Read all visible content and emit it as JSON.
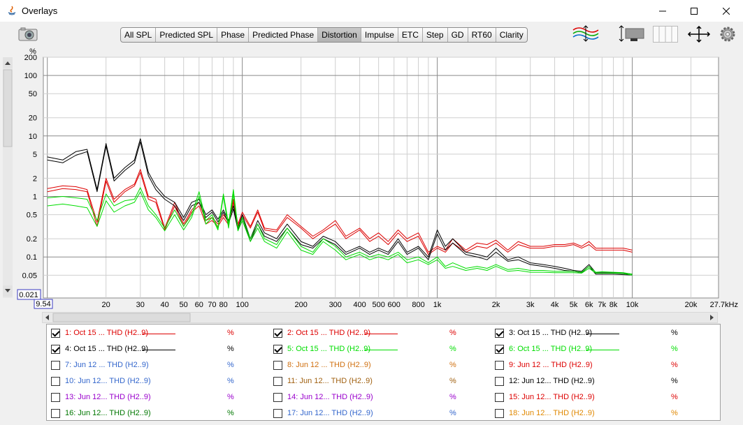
{
  "window": {
    "title": "Overlays"
  },
  "tabs": [
    {
      "label": "All SPL",
      "active": false
    },
    {
      "label": "Predicted SPL",
      "active": false
    },
    {
      "label": "Phase",
      "active": false
    },
    {
      "label": "Predicted Phase",
      "active": false
    },
    {
      "label": "Distortion",
      "active": true
    },
    {
      "label": "Impulse",
      "active": false
    },
    {
      "label": "ETC",
      "active": false
    },
    {
      "label": "Step",
      "active": false
    },
    {
      "label": "GD",
      "active": false
    },
    {
      "label": "RT60",
      "active": false
    },
    {
      "label": "Clarity",
      "active": false
    }
  ],
  "toolbar_icons": [
    "camera-icon",
    "trace-arrangement-icon",
    "limits-icon",
    "columns-icon",
    "pan-arrows-icon",
    "gear-icon"
  ],
  "chart": {
    "y_unit": "%",
    "y_ticks": [
      "200",
      "100",
      "50",
      "20",
      "10",
      "5",
      "2",
      "1",
      "0.5",
      "0.2",
      "0.1",
      "0.05"
    ],
    "y_min_label": "0.021",
    "x_min_label": "9.54",
    "x_ticks": [
      "20",
      "30",
      "40",
      "50",
      "60",
      "70",
      "80",
      "100",
      "200",
      "300",
      "400",
      "500",
      "600",
      "800",
      "1k",
      "2k",
      "3k",
      "4k",
      "5k",
      "6k",
      "7k",
      "8k",
      "10k",
      "20k",
      "27.7kHz"
    ],
    "colors": {
      "red": "#dd0000",
      "black": "#000000",
      "green": "#00dd00"
    }
  },
  "chart_data": {
    "type": "line",
    "xscale": "log",
    "yscale": "log",
    "xlabel": "",
    "ylabel": "%",
    "xlim": [
      9.54,
      27700
    ],
    "ylim": [
      0.021,
      200
    ],
    "series": [
      {
        "color": "#dd0000",
        "x": [
          10,
          12,
          14,
          16,
          18,
          20,
          22,
          25,
          28,
          30,
          33,
          36,
          40,
          45,
          50,
          55,
          60,
          65,
          70,
          75,
          80,
          85,
          90,
          95,
          100,
          110,
          120,
          130,
          150,
          170,
          200,
          230,
          260,
          300,
          340,
          400,
          450,
          500,
          560,
          630,
          700,
          800,
          900,
          1000,
          1100,
          1200,
          1400,
          1600,
          1800,
          2000,
          2300,
          2600,
          3000,
          3500,
          4000,
          4500,
          5000,
          5500,
          6000,
          6500,
          7000,
          8000,
          9000,
          10000
        ],
        "y": [
          1.35,
          1.5,
          1.45,
          1.3,
          0.38,
          2.0,
          0.9,
          1.3,
          1.6,
          2.8,
          1.0,
          0.9,
          0.3,
          0.8,
          0.35,
          0.6,
          0.8,
          0.4,
          0.45,
          0.35,
          0.5,
          0.38,
          0.9,
          0.35,
          0.55,
          0.32,
          0.6,
          0.3,
          0.28,
          0.5,
          0.32,
          0.22,
          0.28,
          0.4,
          0.22,
          0.3,
          0.2,
          0.25,
          0.18,
          0.28,
          0.2,
          0.25,
          0.12,
          0.15,
          0.13,
          0.2,
          0.13,
          0.17,
          0.16,
          0.19,
          0.13,
          0.18,
          0.15,
          0.15,
          0.16,
          0.16,
          0.17,
          0.15,
          0.18,
          0.14,
          0.14,
          0.14,
          0.14,
          0.13
        ]
      },
      {
        "color": "#dd0000",
        "x": [
          10,
          12,
          14,
          16,
          18,
          20,
          22,
          25,
          28,
          30,
          33,
          36,
          40,
          45,
          50,
          55,
          60,
          65,
          70,
          75,
          80,
          85,
          90,
          95,
          100,
          110,
          120,
          130,
          150,
          170,
          200,
          230,
          260,
          300,
          340,
          400,
          450,
          500,
          560,
          630,
          700,
          800,
          900,
          1000,
          1100,
          1200,
          1400,
          1600,
          1800,
          2000,
          2300,
          2600,
          3000,
          3500,
          4000,
          4500,
          5000,
          5500,
          6000,
          6500,
          7000,
          8000,
          9000,
          10000
        ],
        "y": [
          1.2,
          1.35,
          1.3,
          1.2,
          0.32,
          1.8,
          0.8,
          1.2,
          1.5,
          2.5,
          0.9,
          0.8,
          0.28,
          0.7,
          0.32,
          0.55,
          0.7,
          0.35,
          0.4,
          0.32,
          0.45,
          0.34,
          0.8,
          0.32,
          0.5,
          0.3,
          0.55,
          0.28,
          0.26,
          0.45,
          0.3,
          0.2,
          0.26,
          0.35,
          0.2,
          0.28,
          0.18,
          0.22,
          0.16,
          0.25,
          0.18,
          0.22,
          0.11,
          0.14,
          0.12,
          0.17,
          0.12,
          0.15,
          0.14,
          0.17,
          0.12,
          0.16,
          0.14,
          0.14,
          0.15,
          0.15,
          0.16,
          0.14,
          0.16,
          0.13,
          0.13,
          0.13,
          0.13,
          0.12
        ]
      },
      {
        "color": "#000000",
        "x": [
          10,
          12,
          14,
          16,
          18,
          20,
          22,
          25,
          28,
          30,
          33,
          36,
          40,
          45,
          50,
          55,
          60,
          65,
          70,
          75,
          80,
          85,
          90,
          95,
          100,
          110,
          120,
          130,
          150,
          170,
          200,
          230,
          260,
          300,
          340,
          400,
          450,
          500,
          560,
          630,
          700,
          800,
          900,
          1000,
          1100,
          1200,
          1400,
          1600,
          1800,
          2000,
          2300,
          2600,
          3000,
          3500,
          4000,
          4500,
          5000,
          5500,
          6000,
          6500,
          7000,
          8000,
          9000,
          10000
        ],
        "y": [
          4.5,
          4.0,
          5.5,
          6.0,
          1.3,
          7.5,
          2.0,
          3.0,
          4.0,
          9.0,
          2.5,
          1.5,
          1.0,
          0.8,
          0.45,
          0.8,
          0.9,
          0.5,
          0.6,
          0.42,
          0.6,
          0.4,
          0.7,
          0.3,
          0.5,
          0.2,
          0.4,
          0.25,
          0.2,
          0.35,
          0.18,
          0.15,
          0.22,
          0.18,
          0.12,
          0.15,
          0.12,
          0.14,
          0.12,
          0.2,
          0.12,
          0.15,
          0.1,
          0.28,
          0.15,
          0.2,
          0.12,
          0.11,
          0.1,
          0.14,
          0.09,
          0.1,
          0.08,
          0.075,
          0.07,
          0.065,
          0.06,
          0.058,
          0.075,
          0.055,
          0.055,
          0.055,
          0.054,
          0.052
        ]
      },
      {
        "color": "#000000",
        "x": [
          10,
          12,
          14,
          16,
          18,
          20,
          22,
          25,
          28,
          30,
          33,
          36,
          40,
          45,
          50,
          55,
          60,
          65,
          70,
          75,
          80,
          85,
          90,
          95,
          100,
          110,
          120,
          130,
          150,
          170,
          200,
          230,
          260,
          300,
          340,
          400,
          450,
          500,
          560,
          630,
          700,
          800,
          900,
          1000,
          1100,
          1200,
          1400,
          1600,
          1800,
          2000,
          2300,
          2600,
          3000,
          3500,
          4000,
          4500,
          5000,
          5500,
          6000,
          6500,
          7000,
          8000,
          9000,
          10000
        ],
        "y": [
          4.0,
          3.6,
          4.8,
          5.5,
          1.2,
          6.8,
          1.8,
          2.7,
          3.6,
          8.0,
          2.2,
          1.3,
          0.9,
          0.7,
          0.4,
          0.7,
          0.8,
          0.45,
          0.55,
          0.38,
          0.55,
          0.36,
          0.62,
          0.28,
          0.45,
          0.18,
          0.35,
          0.22,
          0.18,
          0.3,
          0.16,
          0.14,
          0.2,
          0.16,
          0.11,
          0.14,
          0.11,
          0.13,
          0.11,
          0.18,
          0.11,
          0.14,
          0.09,
          0.24,
          0.13,
          0.17,
          0.11,
          0.1,
          0.09,
          0.12,
          0.085,
          0.09,
          0.075,
          0.07,
          0.065,
          0.06,
          0.058,
          0.055,
          0.07,
          0.052,
          0.052,
          0.052,
          0.051,
          0.05
        ]
      },
      {
        "color": "#00dd00",
        "x": [
          10,
          12,
          14,
          16,
          18,
          20,
          22,
          25,
          28,
          30,
          33,
          36,
          40,
          45,
          50,
          55,
          60,
          65,
          70,
          75,
          80,
          85,
          90,
          95,
          100,
          110,
          120,
          130,
          150,
          170,
          200,
          230,
          260,
          300,
          340,
          400,
          450,
          500,
          560,
          630,
          700,
          800,
          900,
          1000,
          1100,
          1200,
          1400,
          1600,
          1800,
          2000,
          2300,
          2600,
          3000,
          3500,
          4000,
          4500,
          5000,
          5500,
          6000,
          6500,
          7000,
          8000,
          9000,
          10000
        ],
        "y": [
          0.95,
          1.0,
          0.95,
          0.9,
          0.4,
          1.1,
          0.7,
          0.85,
          0.9,
          1.4,
          0.7,
          0.5,
          0.3,
          0.6,
          0.32,
          0.5,
          1.2,
          0.4,
          0.5,
          0.3,
          1.1,
          0.35,
          1.3,
          0.3,
          0.45,
          0.2,
          0.35,
          0.2,
          0.16,
          0.3,
          0.15,
          0.12,
          0.2,
          0.15,
          0.1,
          0.12,
          0.1,
          0.11,
          0.1,
          0.12,
          0.09,
          0.1,
          0.08,
          0.1,
          0.07,
          0.08,
          0.065,
          0.07,
          0.065,
          0.075,
          0.062,
          0.065,
          0.06,
          0.06,
          0.058,
          0.058,
          0.058,
          0.056,
          0.07,
          0.056,
          0.057,
          0.056,
          0.055,
          0.052
        ]
      },
      {
        "color": "#00dd00",
        "x": [
          10,
          12,
          14,
          16,
          18,
          20,
          22,
          25,
          28,
          30,
          33,
          36,
          40,
          45,
          50,
          55,
          60,
          65,
          70,
          75,
          80,
          85,
          90,
          95,
          100,
          110,
          120,
          130,
          150,
          170,
          200,
          230,
          260,
          300,
          340,
          400,
          450,
          500,
          560,
          630,
          700,
          800,
          900,
          1000,
          1100,
          1200,
          1400,
          1600,
          1800,
          2000,
          2300,
          2600,
          3000,
          3500,
          4000,
          4500,
          5000,
          5500,
          6000,
          6500,
          7000,
          8000,
          9000,
          10000
        ],
        "y": [
          0.7,
          0.75,
          0.7,
          0.65,
          0.32,
          0.85,
          0.55,
          0.7,
          0.8,
          1.2,
          0.6,
          0.45,
          0.27,
          0.5,
          0.28,
          0.45,
          1.0,
          0.35,
          0.45,
          0.28,
          1.0,
          0.3,
          1.1,
          0.27,
          0.4,
          0.18,
          0.3,
          0.18,
          0.14,
          0.26,
          0.13,
          0.11,
          0.18,
          0.13,
          0.09,
          0.11,
          0.09,
          0.1,
          0.09,
          0.11,
          0.08,
          0.09,
          0.075,
          0.09,
          0.065,
          0.07,
          0.06,
          0.065,
          0.06,
          0.07,
          0.058,
          0.06,
          0.056,
          0.056,
          0.055,
          0.055,
          0.055,
          0.054,
          0.065,
          0.054,
          0.054,
          0.054,
          0.053,
          0.05
        ]
      }
    ]
  },
  "legend": [
    {
      "label": "1: Oct 15 ... THD (H2..9)",
      "unit": "%",
      "checked": true,
      "color": "#dd0000",
      "line": true
    },
    {
      "label": "2: Oct 15 ... THD (H2..9)",
      "unit": "%",
      "checked": true,
      "color": "#dd0000",
      "line": true
    },
    {
      "label": "3: Oct 15 ... THD (H2..9)",
      "unit": "%",
      "checked": true,
      "color": "#000000",
      "line": true
    },
    {
      "label": "4: Oct 15 ... THD (H2..9)",
      "unit": "%",
      "checked": true,
      "color": "#000000",
      "line": true
    },
    {
      "label": "5: Oct 15 ... THD (H2..9)",
      "unit": "%",
      "checked": true,
      "color": "#00dd00",
      "line": true
    },
    {
      "label": "6: Oct 15 ... THD (H2..9)",
      "unit": "%",
      "checked": true,
      "color": "#00dd00",
      "line": true
    },
    {
      "label": "7: Jun 12 ... THD (H2..9)",
      "unit": "%",
      "checked": false,
      "color": "#3366cc",
      "line": false
    },
    {
      "label": "8: Jun 12 ... THD (H2..9)",
      "unit": "%",
      "checked": false,
      "color": "#d07010",
      "line": false
    },
    {
      "label": "9: Jun 12 ... THD (H2..9)",
      "unit": "%",
      "checked": false,
      "color": "#dd0000",
      "line": false
    },
    {
      "label": "10: Jun 12... THD (H2..9)",
      "unit": "%",
      "checked": false,
      "color": "#3366cc",
      "line": false
    },
    {
      "label": "11: Jun 12... THD (H2..9)",
      "unit": "%",
      "checked": false,
      "color": "#a06010",
      "line": false
    },
    {
      "label": "12: Jun 12... THD (H2..9)",
      "unit": "%",
      "checked": false,
      "color": "#000000",
      "line": false
    },
    {
      "label": "13: Jun 12... THD (H2..9)",
      "unit": "%",
      "checked": false,
      "color": "#9900cc",
      "line": false
    },
    {
      "label": "14: Jun 12... THD (H2..9)",
      "unit": "%",
      "checked": false,
      "color": "#9900cc",
      "line": false
    },
    {
      "label": "15: Jun 12... THD (H2..9)",
      "unit": "%",
      "checked": false,
      "color": "#dd0000",
      "line": false
    },
    {
      "label": "16: Jun 12... THD (H2..9)",
      "unit": "%",
      "checked": false,
      "color": "#007700",
      "line": false
    },
    {
      "label": "17: Jun 12... THD (H2..9)",
      "unit": "%",
      "checked": false,
      "color": "#3366cc",
      "line": false
    },
    {
      "label": "18: Jun 12... THD (H2..9)",
      "unit": "%",
      "checked": false,
      "color": "#e08800",
      "line": false
    }
  ]
}
